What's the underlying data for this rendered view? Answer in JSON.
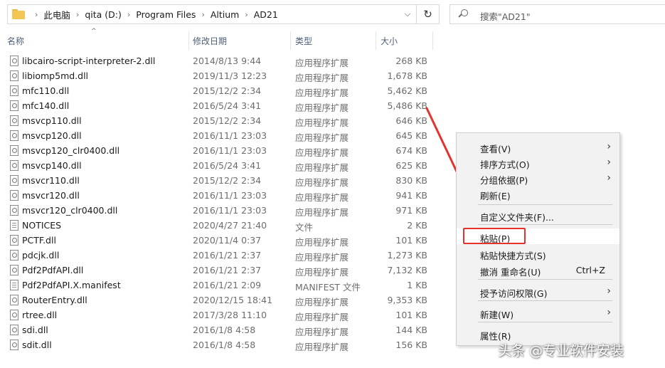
{
  "address": {
    "crumbs": [
      "此电脑",
      "qita (D:)",
      "Program Files",
      "Altium",
      "AD21"
    ],
    "dropdown_icon": "chevron-down-icon",
    "refresh_icon": "refresh-icon"
  },
  "search": {
    "placeholder": "搜索\"AD21\"",
    "icon": "search-icon"
  },
  "columns": {
    "name": "名称",
    "date": "修改日期",
    "type": "类型",
    "size": "大小"
  },
  "files": [
    {
      "name": "libcairo-script-interpreter-2.dll",
      "date": "2014/8/13 9:44",
      "type": "应用程序扩展",
      "size": "268 KB",
      "icon": "dll"
    },
    {
      "name": "libiomp5md.dll",
      "date": "2019/11/3 12:23",
      "type": "应用程序扩展",
      "size": "1,678 KB",
      "icon": "dll"
    },
    {
      "name": "mfc110.dll",
      "date": "2015/12/2 2:34",
      "type": "应用程序扩展",
      "size": "5,462 KB",
      "icon": "dll"
    },
    {
      "name": "mfc140.dll",
      "date": "2016/5/24 3:41",
      "type": "应用程序扩展",
      "size": "5,486 KB",
      "icon": "dll"
    },
    {
      "name": "msvcp110.dll",
      "date": "2015/12/2 2:34",
      "type": "应用程序扩展",
      "size": "646 KB",
      "icon": "dll"
    },
    {
      "name": "msvcp120.dll",
      "date": "2016/11/1 23:03",
      "type": "应用程序扩展",
      "size": "645 KB",
      "icon": "dll"
    },
    {
      "name": "msvcp120_clr0400.dll",
      "date": "2016/11/1 23:03",
      "type": "应用程序扩展",
      "size": "674 KB",
      "icon": "dll"
    },
    {
      "name": "msvcp140.dll",
      "date": "2016/5/24 3:41",
      "type": "应用程序扩展",
      "size": "625 KB",
      "icon": "dll"
    },
    {
      "name": "msvcr110.dll",
      "date": "2015/12/2 2:34",
      "type": "应用程序扩展",
      "size": "830 KB",
      "icon": "dll"
    },
    {
      "name": "msvcr120.dll",
      "date": "2016/11/1 23:03",
      "type": "应用程序扩展",
      "size": "941 KB",
      "icon": "dll"
    },
    {
      "name": "msvcr120_clr0400.dll",
      "date": "2016/11/1 23:03",
      "type": "应用程序扩展",
      "size": "971 KB",
      "icon": "dll"
    },
    {
      "name": "NOTICES",
      "date": "2020/4/27 21:40",
      "type": "文件",
      "size": "2 KB",
      "icon": "doc"
    },
    {
      "name": "PCTF.dll",
      "date": "2020/11/4 0:37",
      "type": "应用程序扩展",
      "size": "101 KB",
      "icon": "dll"
    },
    {
      "name": "pdcjk.dll",
      "date": "2016/1/21 2:37",
      "type": "应用程序扩展",
      "size": "1,273 KB",
      "icon": "dll"
    },
    {
      "name": "Pdf2PdfAPI.dll",
      "date": "2016/1/21 2:37",
      "type": "应用程序扩展",
      "size": "7,132 KB",
      "icon": "dll"
    },
    {
      "name": "Pdf2PdfAPI.X.manifest",
      "date": "2016/1/21 2:09",
      "type": "MANIFEST 文件",
      "size": "1 KB",
      "icon": "doc"
    },
    {
      "name": "RouterEntry.dll",
      "date": "2020/12/15 18:41",
      "type": "应用程序扩展",
      "size": "9,353 KB",
      "icon": "dll"
    },
    {
      "name": "rtree.dll",
      "date": "2017/3/28 11:10",
      "type": "应用程序扩展",
      "size": "101 KB",
      "icon": "dll"
    },
    {
      "name": "sdi.dll",
      "date": "2016/1/8 4:58",
      "type": "应用程序扩展",
      "size": "144 KB",
      "icon": "dll"
    },
    {
      "name": "sdit.dll",
      "date": "2016/1/8 4:58",
      "type": "应用程序扩展",
      "size": "156 KB",
      "icon": "dll"
    }
  ],
  "context_menu": {
    "items": [
      {
        "label": "查看(V)",
        "submenu": true
      },
      {
        "label": "排序方式(O)",
        "submenu": true
      },
      {
        "label": "分组依据(P)",
        "submenu": true
      },
      {
        "label": "刷新(E)"
      },
      {
        "label": "自定义文件夹(F)..."
      },
      {
        "label": "粘贴(P)",
        "highlighted": true
      },
      {
        "label": "粘贴快捷方式(S)"
      },
      {
        "label": "撤消 重命名(U)",
        "shortcut": "Ctrl+Z"
      },
      {
        "label": "授予访问权限(G)",
        "submenu": true
      },
      {
        "label": "新建(W)",
        "submenu": true
      },
      {
        "label": "属性(R)"
      }
    ]
  },
  "annotation": {
    "arrow_color": "#e5322d",
    "highlight_color": "#e5322d"
  },
  "watermark": "头条 @专业软件安装"
}
